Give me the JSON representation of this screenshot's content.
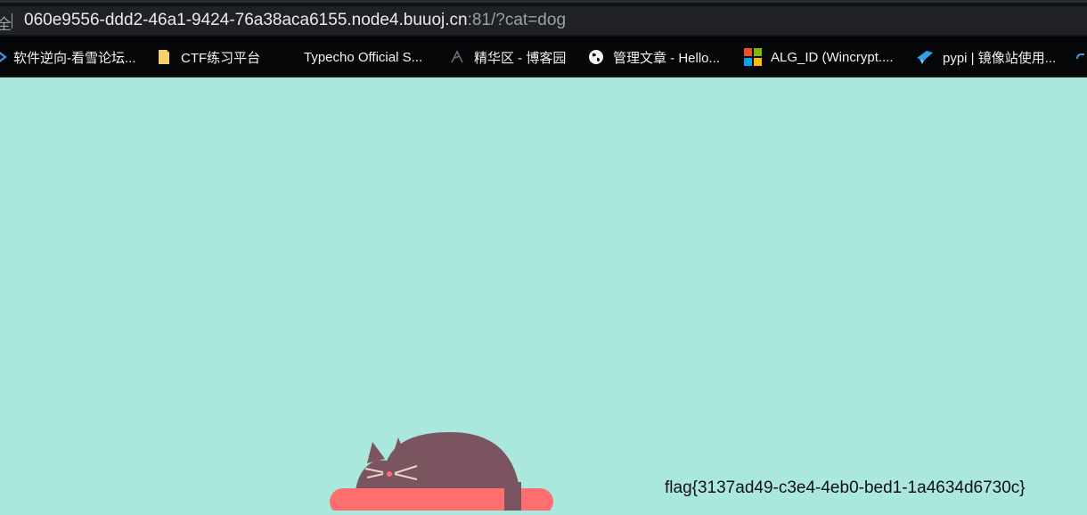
{
  "browser": {
    "address_bar": {
      "host": "060e9556-ddd2-46a1-9424-76a38aca6155.node4.buuoj.cn",
      "rest": ":81/?cat=dog"
    },
    "bookmarks": [
      {
        "label": "软件逆向-看雪论坛...",
        "icon": "kanxue-icon"
      },
      {
        "label": "CTF练习平台",
        "icon": "folder-icon"
      },
      {
        "label": "Typecho Official S...",
        "icon": "typecho-icon"
      },
      {
        "label": "精华区 - 博客园",
        "icon": "cnblogs-icon"
      },
      {
        "label": "管理文章 - Hello...",
        "icon": "globe-icon"
      },
      {
        "label": "ALG_ID (Wincrypt....",
        "icon": "microsoft-icon"
      },
      {
        "label": "pypi | 镜像站使用...",
        "icon": "pypi-icon"
      }
    ]
  },
  "page": {
    "flag_text": "flag{3137ad49-c3e4-4eb0-bed1-1a4634d6730c}",
    "illustration": "sleeping-cat-on-cushion",
    "colors": {
      "background": "#aae7dc",
      "cat": "#7a5560",
      "cushion": "#ff6f6f"
    }
  }
}
